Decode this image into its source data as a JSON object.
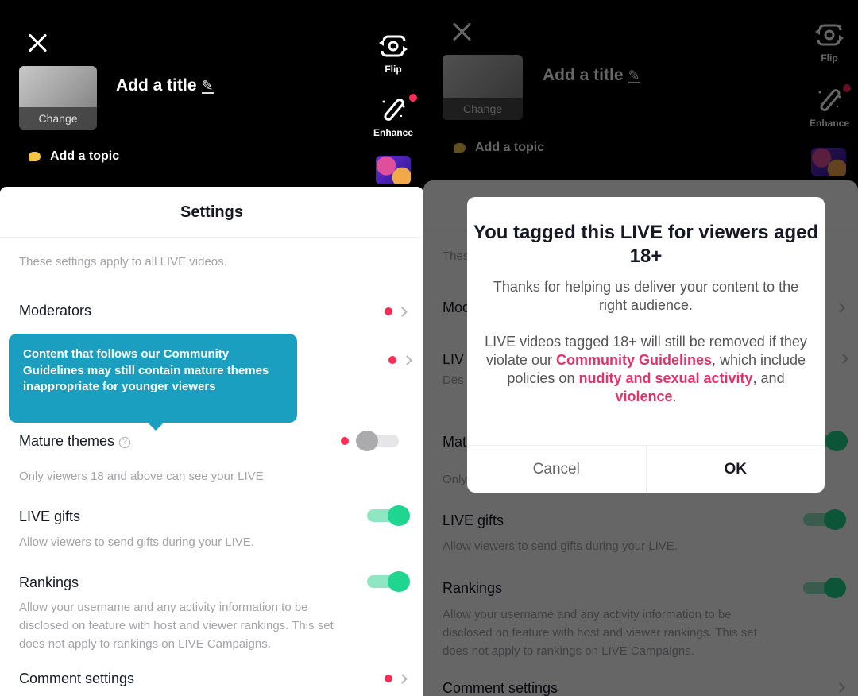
{
  "header": {
    "thumbnail_change_label": "Change",
    "title_placeholder": "Add a title",
    "topic_label": "Add a topic",
    "tools": [
      {
        "label": "Flip",
        "icon": "flip-camera-icon"
      },
      {
        "label": "Enhance",
        "icon": "magic-wand-icon",
        "badge": true
      }
    ]
  },
  "settings": {
    "title": "Settings",
    "note": "These settings apply to all LIVE videos.",
    "rows": [
      {
        "label": "Moderators",
        "type": "link",
        "badge": true
      },
      {
        "label": "LIV",
        "desc": "Des",
        "type": "link",
        "badge": true
      },
      {
        "label": "Mature themes",
        "desc": "Only viewers 18 and above can see your LIVE",
        "type": "toggle",
        "badge": true
      },
      {
        "label": "LIVE gifts",
        "desc": "Allow viewers to send gifts during your LIVE.",
        "type": "toggle",
        "on": true
      },
      {
        "label": "Rankings",
        "desc_lines": [
          "Allow your username and any activity information to be",
          "disclosed on feature with host and viewer rankings. This set",
          "does not apply to rankings on LIVE Campaigns."
        ],
        "type": "toggle",
        "on": true
      },
      {
        "label": "Comment settings",
        "type": "link",
        "badge": true
      }
    ],
    "mature_themes_left_on": false,
    "mature_themes_right_on": true
  },
  "tooltip": {
    "text": "Content that follows our Community Guidelines may still contain mature themes inappropriate for younger viewers"
  },
  "dialog": {
    "title": "You tagged this LIVE for viewers aged 18+",
    "para1": "Thanks for helping us deliver your content to the right audience.",
    "para2_a": "LIVE videos tagged 18+ will still be removed if they violate our ",
    "link_guidelines": "Community Guidelines",
    "para2_b": ", which include policies on ",
    "link_nudity": "nudity and sexual activity",
    "para2_c": ", and ",
    "link_violence": "violence",
    "para2_d": ".",
    "cancel_label": "Cancel",
    "ok_label": "OK"
  },
  "colors": {
    "accent_red": "#fe2c55",
    "toggle_green": "#20d58f",
    "tooltip_blue": "#1a9fc1",
    "link_pink": "#e0336a"
  }
}
